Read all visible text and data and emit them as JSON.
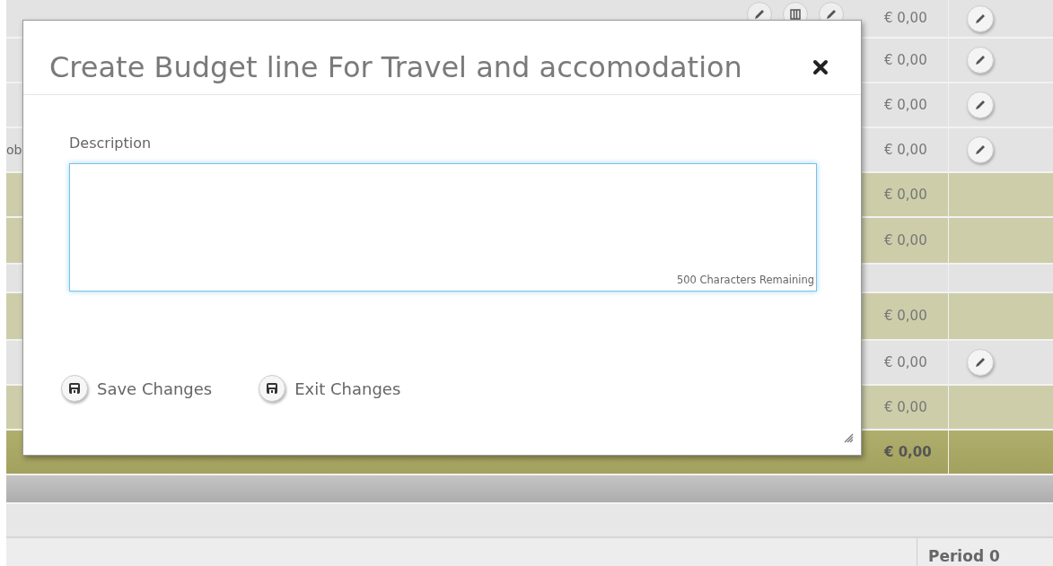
{
  "background_table": {
    "rows": [
      {
        "kind": "item",
        "amount": "€ 0,00",
        "editable": true,
        "tools": [
          {
            "kind": "pencil"
          },
          {
            "kind": "grid"
          },
          {
            "kind": "pencil"
          }
        ]
      },
      {
        "kind": "item",
        "amount": "€ 0,00",
        "editable": true
      },
      {
        "kind": "item",
        "amount": "€ 0,00",
        "editable": true
      },
      {
        "kind": "item",
        "amount": "€ 0,00",
        "editable": true,
        "label": "ob"
      },
      {
        "kind": "subtotal",
        "amount": "€ 0,00",
        "editable": false
      },
      {
        "kind": "subtotal",
        "amount": "€ 0,00",
        "editable": false
      },
      {
        "kind": "blank",
        "editable": false
      },
      {
        "kind": "subtotal",
        "amount": "€ 0,00",
        "editable": false
      },
      {
        "kind": "item",
        "amount": "€ 0,00",
        "editable": true
      },
      {
        "kind": "subtotal",
        "amount": "€ 0,00",
        "editable": false
      },
      {
        "kind": "total",
        "amount": "€ 0,00",
        "editable": false
      }
    ],
    "footer_header": "Period 0"
  },
  "dialog": {
    "title": "Create Budget line For Travel and accomodation",
    "description": {
      "label": "Description",
      "focused": true,
      "counter": "500 Characters Remaining"
    },
    "buttons": [
      {
        "label": "Save Changes"
      },
      {
        "label": "Exit Changes"
      }
    ]
  }
}
